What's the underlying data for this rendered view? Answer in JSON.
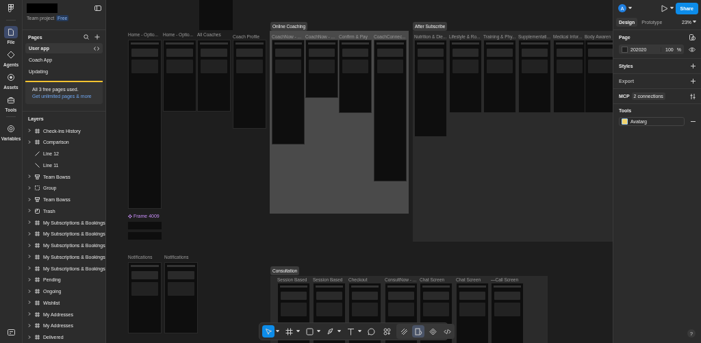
{
  "left_rail": {
    "items": [
      {
        "label": "File",
        "kind": "file",
        "selected": true
      },
      {
        "label": "Agents",
        "kind": "agents",
        "selected": false
      },
      {
        "label": "Assets",
        "kind": "assets",
        "selected": false
      },
      {
        "label": "Tools",
        "kind": "tools",
        "selected": false
      },
      {
        "label": "Variables",
        "kind": "variables",
        "selected": false
      }
    ]
  },
  "file": {
    "team": "Team project",
    "badge": "Free"
  },
  "pages": {
    "title": "Pages",
    "items": [
      {
        "label": "User app",
        "selected": true
      },
      {
        "label": "Coach App",
        "selected": false
      },
      {
        "label": "Updating",
        "selected": false
      }
    ]
  },
  "upgrade_notice": {
    "message": "All 3 free pages used.",
    "link": "Get unlimited pages & more"
  },
  "layers": {
    "title": "Layers",
    "items": [
      {
        "name": "Check-ins History",
        "kind": "frame"
      },
      {
        "name": "Comparison",
        "kind": "frame"
      },
      {
        "name": "Line 12",
        "kind": "line-rising"
      },
      {
        "name": "Line 11",
        "kind": "line-falling"
      },
      {
        "name": "Team Bowss",
        "kind": "auto-layout"
      },
      {
        "name": "Group",
        "kind": "group"
      },
      {
        "name": "Team Bowss",
        "kind": "auto-layout"
      },
      {
        "name": "Trash",
        "kind": "section"
      },
      {
        "name": "My Subscriptions & Bookings",
        "kind": "frame"
      },
      {
        "name": "My Subscriptions & Bookings",
        "kind": "frame"
      },
      {
        "name": "My Subscriptions & Bookings",
        "kind": "frame"
      },
      {
        "name": "My Subscriptions & Bookings",
        "kind": "frame"
      },
      {
        "name": "My Subscriptions & Bookings",
        "kind": "frame"
      },
      {
        "name": "Pending",
        "kind": "frame"
      },
      {
        "name": "Ongoing",
        "kind": "frame"
      },
      {
        "name": "Wishlist",
        "kind": "frame"
      },
      {
        "name": "My Addresses",
        "kind": "frame"
      },
      {
        "name": "My Addresses",
        "kind": "frame"
      },
      {
        "name": "Delivered",
        "kind": "frame"
      }
    ]
  },
  "canvas": {
    "frames": [
      "Home - Optio...",
      "Home - Optio...",
      "All Coaches",
      "Coach Profile",
      "Notifications",
      "Notifications"
    ],
    "component_label": "Frame 4009",
    "sections": [
      {
        "title": "Online Coaching",
        "frames": [
          "CoachNow - ...",
          "CoachNow - ...",
          "Confirm & Pay",
          "CoachConnec..."
        ]
      },
      {
        "title": "After Subscribe",
        "frames": [
          "Nutrition & Die...",
          "Lifestyle & Ro...",
          "Training & Phy...",
          "Supplementati...",
          "Medical Infor...",
          "Body Awaren"
        ]
      },
      {
        "title": "Consultation",
        "frames": [
          "Session Based",
          "Session Based",
          "Checkout",
          "ConsultNow - ...",
          "Chat Screen",
          "Chat Screen",
          "—Call Screen"
        ]
      }
    ]
  },
  "toolbar": {
    "tools": [
      {
        "kind": "move",
        "selected": true
      },
      {
        "kind": "frame",
        "selected": false
      },
      {
        "kind": "shape",
        "selected": false
      },
      {
        "kind": "pen",
        "selected": false
      },
      {
        "kind": "text",
        "selected": false
      },
      {
        "kind": "comment",
        "selected": false
      },
      {
        "kind": "actions",
        "selected": false
      }
    ],
    "modes": [
      {
        "kind": "draw",
        "selected": false
      },
      {
        "kind": "design",
        "selected": true
      },
      {
        "kind": "component",
        "selected": false
      },
      {
        "kind": "code",
        "selected": false
      }
    ]
  },
  "right_panel": {
    "avatar": "A",
    "share": "Share",
    "tabs": [
      {
        "label": "Design",
        "selected": true
      },
      {
        "label": "Prototype",
        "selected": false
      }
    ],
    "zoom": "23%",
    "page": {
      "title": "Page",
      "fill": "202020",
      "opacity": "100",
      "unit": "%"
    },
    "styles": "Styles",
    "export": "Export",
    "mcp": {
      "label": "MCP",
      "connections": "2 connections"
    },
    "tools": {
      "title": "Tools",
      "plugin": "Avatarg"
    },
    "help": "?"
  }
}
